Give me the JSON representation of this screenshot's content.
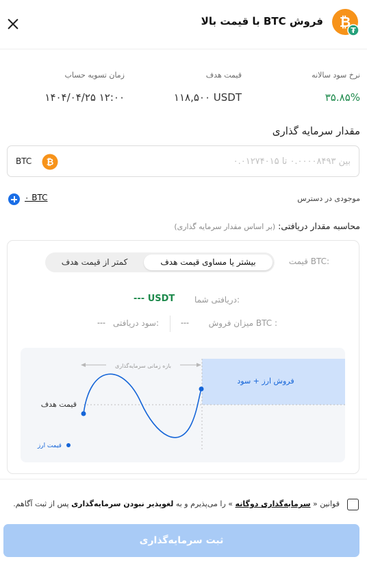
{
  "header": {
    "title": "فروش BTC با قیمت بالا",
    "coin_icon": "bitcoin-icon",
    "badge_icon": "tether-icon"
  },
  "info": {
    "apr_label": "نرخ سود سالانه",
    "apr_value": "۳۵.۸۵%",
    "target_label": "قیمت هدف",
    "target_value": "۱۱۸,۵۰۰ USDT",
    "settle_label": "زمان تسویه حساب",
    "settle_value": "۱۴۰۴/۰۴/۲۵ ۱۲:۰۰"
  },
  "investment": {
    "title": "مقدار سرمایه گذاری",
    "placeholder": "بین ۰.۰۰۰۰۸۴۹۳ تا ۰.۰۱۲۷۴۰۱۵",
    "unit": "BTC",
    "available_label": "موجودی در دسترس",
    "available_value": "۰ BTC"
  },
  "calc": {
    "title": "محاسبه مقدار دریافتی:",
    "subtitle": "(بر اساس مقدار سرمایه گذاری)",
    "price_label": "قیمت BTC:",
    "option_ge": "بیشتر یا مساوی قیمت هدف",
    "option_lt": "کمتر از قیمت هدف",
    "receive_label": "دریافتی شما:",
    "receive_value": "--- USDT",
    "sell_label": "میزان فروش BTC :",
    "sell_value": "---",
    "profit_label": "سود دریافتی:",
    "profit_value": "---"
  },
  "diagram": {
    "period_label": "بازه زمانی سرمایه‌گذاری",
    "target_label": "قیمت هدف",
    "sell_label": "فروش ارز + سود",
    "legend_label": "قیمت ارز",
    "colors": {
      "curve": "#1565d8",
      "region": "#cfe1fb",
      "grid": "#bfbfbf"
    }
  },
  "terms": {
    "prefix": "قوانین «",
    "link": "سرمایه‌گذاری دوگانه",
    "middle": "» را می‌پذیرم و به",
    "bold": "لغوپذیر نبودن سرمایه‌گذاری",
    "suffix": "پس از ثبت آگاهم."
  },
  "submit_label": "ثبت سرمایه‌گذاری",
  "colors": {
    "accent": "#1a6ee6",
    "positive": "#1e8a4c",
    "submit_disabled": "#a9cbf6",
    "bitcoin": "#f7931a",
    "tether": "#26a17b"
  }
}
